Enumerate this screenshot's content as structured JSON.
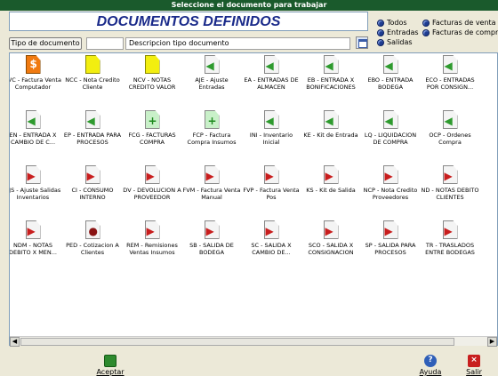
{
  "window": {
    "title": "Seleccione el documento para trabajar"
  },
  "header": {
    "title": "DOCUMENTOS DEFINIDOS"
  },
  "filters": {
    "todos": "Todos",
    "entradas": "Entradas",
    "salidas": "Salidas",
    "facturas_venta": "Facturas de venta",
    "facturas_compra": "Facturas de compra"
  },
  "search": {
    "tipo_button": "Tipo de documento",
    "tipo_value": "",
    "descripcion_value": "Descripcion tipo documento"
  },
  "documents": [
    {
      "label": "FVC - Factura Venta Computador",
      "icon": "money-icon"
    },
    {
      "label": "NCC - Nota Credito Cliente",
      "icon": "yellow-note-icon"
    },
    {
      "label": "NCV - NOTAS CREDITO VALOR",
      "icon": "yellow-note-icon"
    },
    {
      "label": "AJE - Ajuste Entradas Inventarios",
      "icon": "entry-doc-icon"
    },
    {
      "label": "EA - ENTRADAS DE ALMACEN",
      "icon": "entry-doc-icon"
    },
    {
      "label": "EB - ENTRADA X BONIFICACIONES",
      "icon": "entry-doc-icon"
    },
    {
      "label": "EBO - ENTRADA BODEGA",
      "icon": "entry-doc-icon"
    },
    {
      "label": "ECO - ENTRADAS POR CONSIGN...",
      "icon": "entry-doc-icon"
    },
    {
      "label": "EN - ENTRADA X CAMBIO DE C...",
      "icon": "entry-doc-icon"
    },
    {
      "label": "EP - ENTRADA PARA PROCESOS",
      "icon": "entry-doc-icon"
    },
    {
      "label": "FCG - FACTURAS COMPRA",
      "icon": "purchase-doc-icon"
    },
    {
      "label": "FCP - Factura Compra Insumos",
      "icon": "purchase-doc-icon"
    },
    {
      "label": "INI - Inventario Inicial",
      "icon": "entry-doc-icon"
    },
    {
      "label": "KE - Kit de Entrada",
      "icon": "entry-doc-icon"
    },
    {
      "label": "LQ - LIQUIDACION DE COMPRA",
      "icon": "entry-doc-icon"
    },
    {
      "label": "OCP - Ordenes Compra Proveedores",
      "icon": "entry-doc-icon"
    },
    {
      "label": "AJS - Ajuste Salidas Inventarios",
      "icon": "exit-doc-icon"
    },
    {
      "label": "CI - CONSUMO INTERNO",
      "icon": "exit-doc-icon"
    },
    {
      "label": "DV - DEVOLUCION A PROVEEDOR",
      "icon": "exit-doc-icon"
    },
    {
      "label": "FVM - Factura Venta Manual",
      "icon": "exit-doc-icon"
    },
    {
      "label": "FVP - Factura Venta Pos",
      "icon": "exit-doc-icon"
    },
    {
      "label": "KS - Kit de Salida",
      "icon": "exit-doc-icon"
    },
    {
      "label": "NCP - Nota Credito Proveedores",
      "icon": "exit-doc-icon"
    },
    {
      "label": "ND - NOTAS DEBITO CLIENTES",
      "icon": "exit-doc-icon"
    },
    {
      "label": "NDM - NOTAS DEBITO X MEN...",
      "icon": "exit-doc-icon"
    },
    {
      "label": "PED - Cotizacion A Clientes",
      "icon": "person-doc-icon"
    },
    {
      "label": "REM - Remisiones Ventas Insumos",
      "icon": "exit-doc-icon"
    },
    {
      "label": "SB - SALIDA DE BODEGA",
      "icon": "exit-doc-icon"
    },
    {
      "label": "SC - SALIDA X CAMBIO DE...",
      "icon": "exit-doc-icon"
    },
    {
      "label": "SCO - SALIDA X CONSIGNACION",
      "icon": "exit-doc-icon"
    },
    {
      "label": "SP - SALIDA PARA PROCESOS",
      "icon": "exit-doc-icon"
    },
    {
      "label": "TR - TRASLADOS ENTRE BODEGAS",
      "icon": "exit-doc-icon"
    }
  ],
  "footer": {
    "accept_label": "Aceptar",
    "help_label": "Ayuda",
    "exit_label": "Salir"
  }
}
